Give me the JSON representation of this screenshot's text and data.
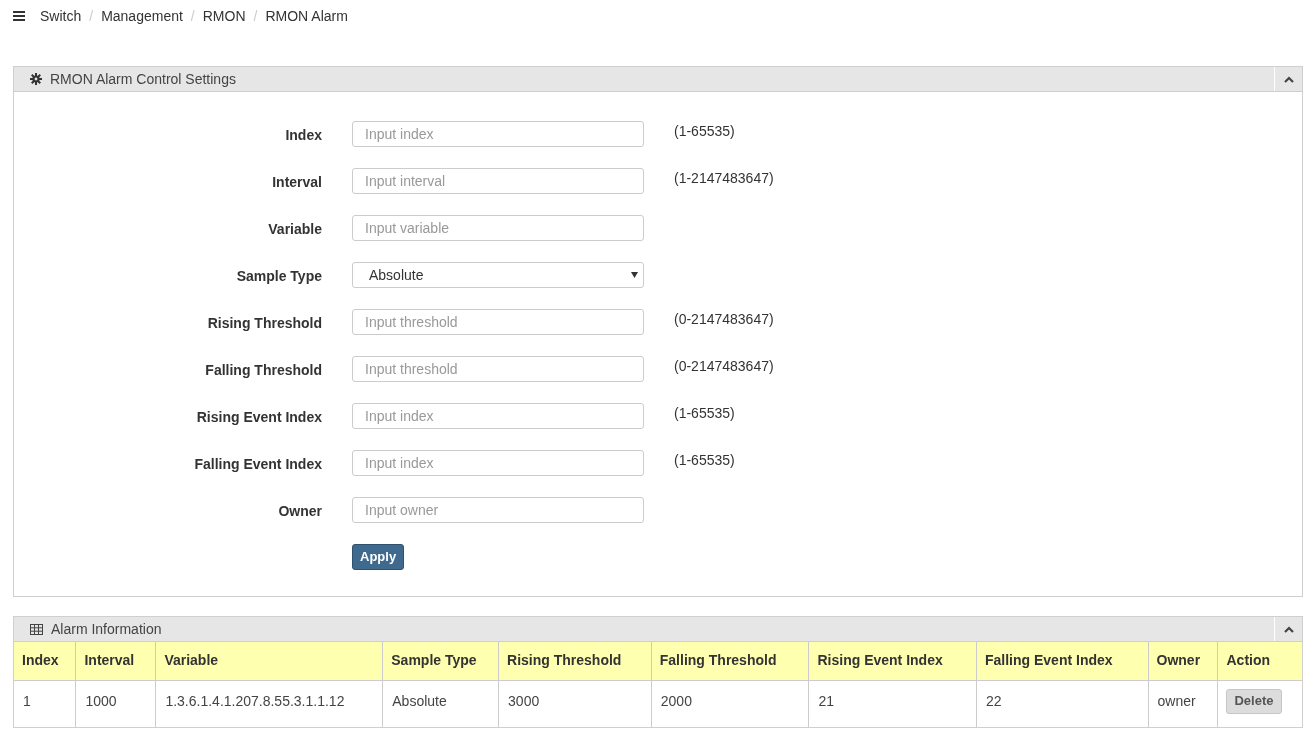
{
  "breadcrumb": {
    "separator": "/",
    "items": [
      "Switch",
      "Management",
      "RMON",
      "RMON Alarm"
    ]
  },
  "settings_panel": {
    "title": "RMON Alarm Control Settings",
    "expanded": true,
    "fields": [
      {
        "kind": "input",
        "label": "Index",
        "placeholder": "Input index",
        "hint": "(1-65535)"
      },
      {
        "kind": "input",
        "label": "Interval",
        "placeholder": "Input interval",
        "hint": "(1-2147483647)"
      },
      {
        "kind": "input",
        "label": "Variable",
        "placeholder": "Input variable"
      },
      {
        "kind": "select",
        "label": "Sample Type",
        "value": "Absolute"
      },
      {
        "kind": "input",
        "label": "Rising Threshold",
        "placeholder": "Input threshold",
        "hint": "(0-2147483647)"
      },
      {
        "kind": "input",
        "label": "Falling Threshold",
        "placeholder": "Input threshold",
        "hint": "(0-2147483647)"
      },
      {
        "kind": "input",
        "label": "Rising Event Index",
        "placeholder": "Input index",
        "hint": "(1-65535)"
      },
      {
        "kind": "input",
        "label": "Falling Event Index",
        "placeholder": "Input index",
        "hint": "(1-65535)"
      },
      {
        "kind": "input",
        "label": "Owner",
        "placeholder": "Input owner"
      }
    ],
    "apply_button": "Apply"
  },
  "alarm_panel": {
    "title": "Alarm Information",
    "expanded": true,
    "table": {
      "columns": [
        "Index",
        "Interval",
        "Variable",
        "Sample Type",
        "Rising Threshold",
        "Falling Threshold",
        "Rising Event Index",
        "Falling Event Index",
        "Owner",
        "Action"
      ],
      "rows": [
        {
          "cells": [
            "1",
            "1000",
            "1.3.6.1.4.1.207.8.55.3.1.1.12",
            "Absolute",
            "3000",
            "2000",
            "21",
            "22",
            "owner"
          ],
          "action": "Delete"
        }
      ]
    }
  }
}
